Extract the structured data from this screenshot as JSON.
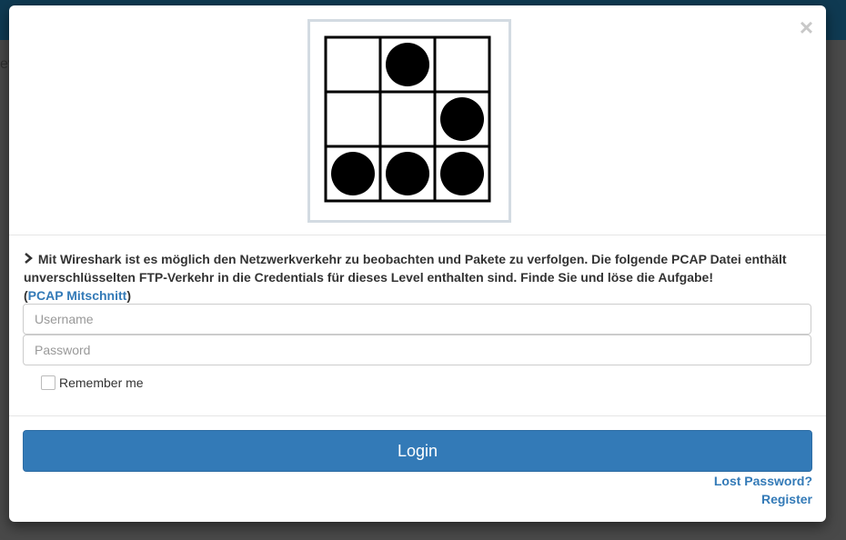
{
  "background": {
    "fragment": "ev"
  },
  "modal": {
    "close_label": "×",
    "logo": {
      "name": "glider-emblem",
      "grid": [
        [
          0,
          1,
          0
        ],
        [
          0,
          0,
          1
        ],
        [
          1,
          1,
          1
        ]
      ]
    },
    "description": {
      "text": "Mit Wireshark ist es möglich den Netzwerkverkehr zu beobachten und Pakete zu verfolgen. Die folgende PCAP Datei enthält unverschlüsselten FTP-Verkehr in die Credentials für dieses Level enthalten sind. Finde Sie und löse die Aufgabe!",
      "link_open": "(",
      "link_label": "PCAP Mitschnitt",
      "link_close": ")"
    },
    "username": {
      "placeholder": "Username",
      "value": ""
    },
    "password": {
      "placeholder": "Password",
      "value": ""
    },
    "remember_label": "Remember me",
    "login_label": "Login",
    "lost_password_label": "Lost Password?",
    "register_label": "Register"
  },
  "colors": {
    "primary": "#337ab7",
    "topbar": "#0f3a52",
    "logo_border": "#d3dbe2"
  }
}
